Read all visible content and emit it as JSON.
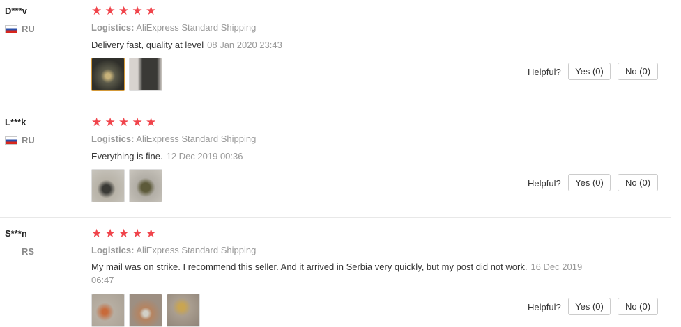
{
  "reviews": [
    {
      "user": "D***v",
      "country": "RU",
      "has_flag": true,
      "stars": [
        "★",
        "★",
        "★",
        "★",
        "★"
      ],
      "logistics_label": "Logistics:",
      "logistics_value": "AliExpress Standard Shipping",
      "text": "Delivery fast, quality at level",
      "date": "08 Jan 2020 23:43",
      "helpful_label": "Helpful?",
      "yes_label": "Yes (0)",
      "no_label": "No (0)"
    },
    {
      "user": "L***k",
      "country": "RU",
      "has_flag": true,
      "stars": [
        "★",
        "★",
        "★",
        "★",
        "★"
      ],
      "logistics_label": "Logistics:",
      "logistics_value": "AliExpress Standard Shipping",
      "text": "Everything is fine.",
      "date": "12 Dec 2019 00:36",
      "helpful_label": "Helpful?",
      "yes_label": "Yes (0)",
      "no_label": "No (0)"
    },
    {
      "user": "S***n",
      "country": "RS",
      "has_flag": false,
      "stars": [
        "★",
        "★",
        "★",
        "★",
        "★"
      ],
      "logistics_label": "Logistics:",
      "logistics_value": "AliExpress Standard Shipping",
      "text": "My mail was on strike. I recommend this seller. And it arrived in Serbia very quickly, but my post did not work.",
      "date": "16 Dec 2019 06:47",
      "helpful_label": "Helpful?",
      "yes_label": "Yes (0)",
      "no_label": "No (0)"
    }
  ],
  "colors": {
    "star": "#f0444b",
    "muted_text": "#999999",
    "active_thumb_border": "#d49a3a"
  }
}
